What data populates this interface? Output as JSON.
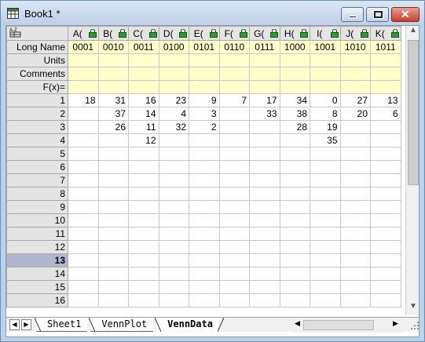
{
  "window": {
    "title": "Book1 *"
  },
  "columns": [
    {
      "name": "A(X)",
      "display": "A(",
      "long_name": "0001"
    },
    {
      "name": "B(Y)",
      "display": "B(",
      "long_name": "0010"
    },
    {
      "name": "C(Y)",
      "display": "C(",
      "long_name": "0011"
    },
    {
      "name": "D(Y)",
      "display": "D(",
      "long_name": "0100"
    },
    {
      "name": "E(Y)",
      "display": "E(",
      "long_name": "0101"
    },
    {
      "name": "F(Y)",
      "display": "F(",
      "long_name": "0110"
    },
    {
      "name": "G(Y)",
      "display": "G(",
      "long_name": "0111"
    },
    {
      "name": "H(Y)",
      "display": "H(",
      "long_name": "1000"
    },
    {
      "name": "I(Y)",
      "display": "I(",
      "long_name": "1001"
    },
    {
      "name": "J(Y)",
      "display": "J(",
      "long_name": "1010"
    },
    {
      "name": "K(Y)",
      "display": "K(",
      "long_name": "1011"
    }
  ],
  "meta_rows": [
    "Long Name",
    "Units",
    "Comments",
    "F(x)="
  ],
  "rows": [
    {
      "label": "1",
      "cells": [
        "18",
        "31",
        "16",
        "23",
        "9",
        "7",
        "17",
        "34",
        "0",
        "27",
        "13"
      ]
    },
    {
      "label": "2",
      "cells": [
        "",
        "37",
        "14",
        "4",
        "3",
        "",
        "33",
        "38",
        "8",
        "20",
        "6"
      ]
    },
    {
      "label": "3",
      "cells": [
        "",
        "26",
        "11",
        "32",
        "2",
        "",
        "",
        "28",
        "19",
        "",
        ""
      ]
    },
    {
      "label": "4",
      "cells": [
        "",
        "",
        "12",
        "",
        "",
        "",
        "",
        "",
        "35",
        "",
        ""
      ]
    },
    {
      "label": "5",
      "cells": [
        "",
        "",
        "",
        "",
        "",
        "",
        "",
        "",
        "",
        "",
        ""
      ]
    },
    {
      "label": "6",
      "cells": [
        "",
        "",
        "",
        "",
        "",
        "",
        "",
        "",
        "",
        "",
        ""
      ]
    },
    {
      "label": "7",
      "cells": [
        "",
        "",
        "",
        "",
        "",
        "",
        "",
        "",
        "",
        "",
        ""
      ]
    },
    {
      "label": "8",
      "cells": [
        "",
        "",
        "",
        "",
        "",
        "",
        "",
        "",
        "",
        "",
        ""
      ]
    },
    {
      "label": "9",
      "cells": [
        "",
        "",
        "",
        "",
        "",
        "",
        "",
        "",
        "",
        "",
        ""
      ]
    },
    {
      "label": "10",
      "cells": [
        "",
        "",
        "",
        "",
        "",
        "",
        "",
        "",
        "",
        "",
        ""
      ]
    },
    {
      "label": "11",
      "cells": [
        "",
        "",
        "",
        "",
        "",
        "",
        "",
        "",
        "",
        "",
        ""
      ]
    },
    {
      "label": "12",
      "cells": [
        "",
        "",
        "",
        "",
        "",
        "",
        "",
        "",
        "",
        "",
        ""
      ]
    },
    {
      "label": "13",
      "cells": [
        "",
        "",
        "",
        "",
        "",
        "",
        "",
        "",
        "",
        "",
        ""
      ],
      "selected": true
    },
    {
      "label": "14",
      "cells": [
        "",
        "",
        "",
        "",
        "",
        "",
        "",
        "",
        "",
        "",
        ""
      ]
    },
    {
      "label": "15",
      "cells": [
        "",
        "",
        "",
        "",
        "",
        "",
        "",
        "",
        "",
        "",
        ""
      ]
    },
    {
      "label": "16",
      "cells": [
        "",
        "",
        "",
        "",
        "",
        "",
        "",
        "",
        "",
        "",
        ""
      ]
    }
  ],
  "sheets": [
    {
      "label": "Sheet1",
      "active": false
    },
    {
      "label": "VennPlot",
      "active": false
    },
    {
      "label": "VennData",
      "active": true
    }
  ],
  "colors": {
    "meta_bg": "#ffffcc",
    "selected_row": "#b0b6d0",
    "lock_icon": "#2aa02a"
  }
}
